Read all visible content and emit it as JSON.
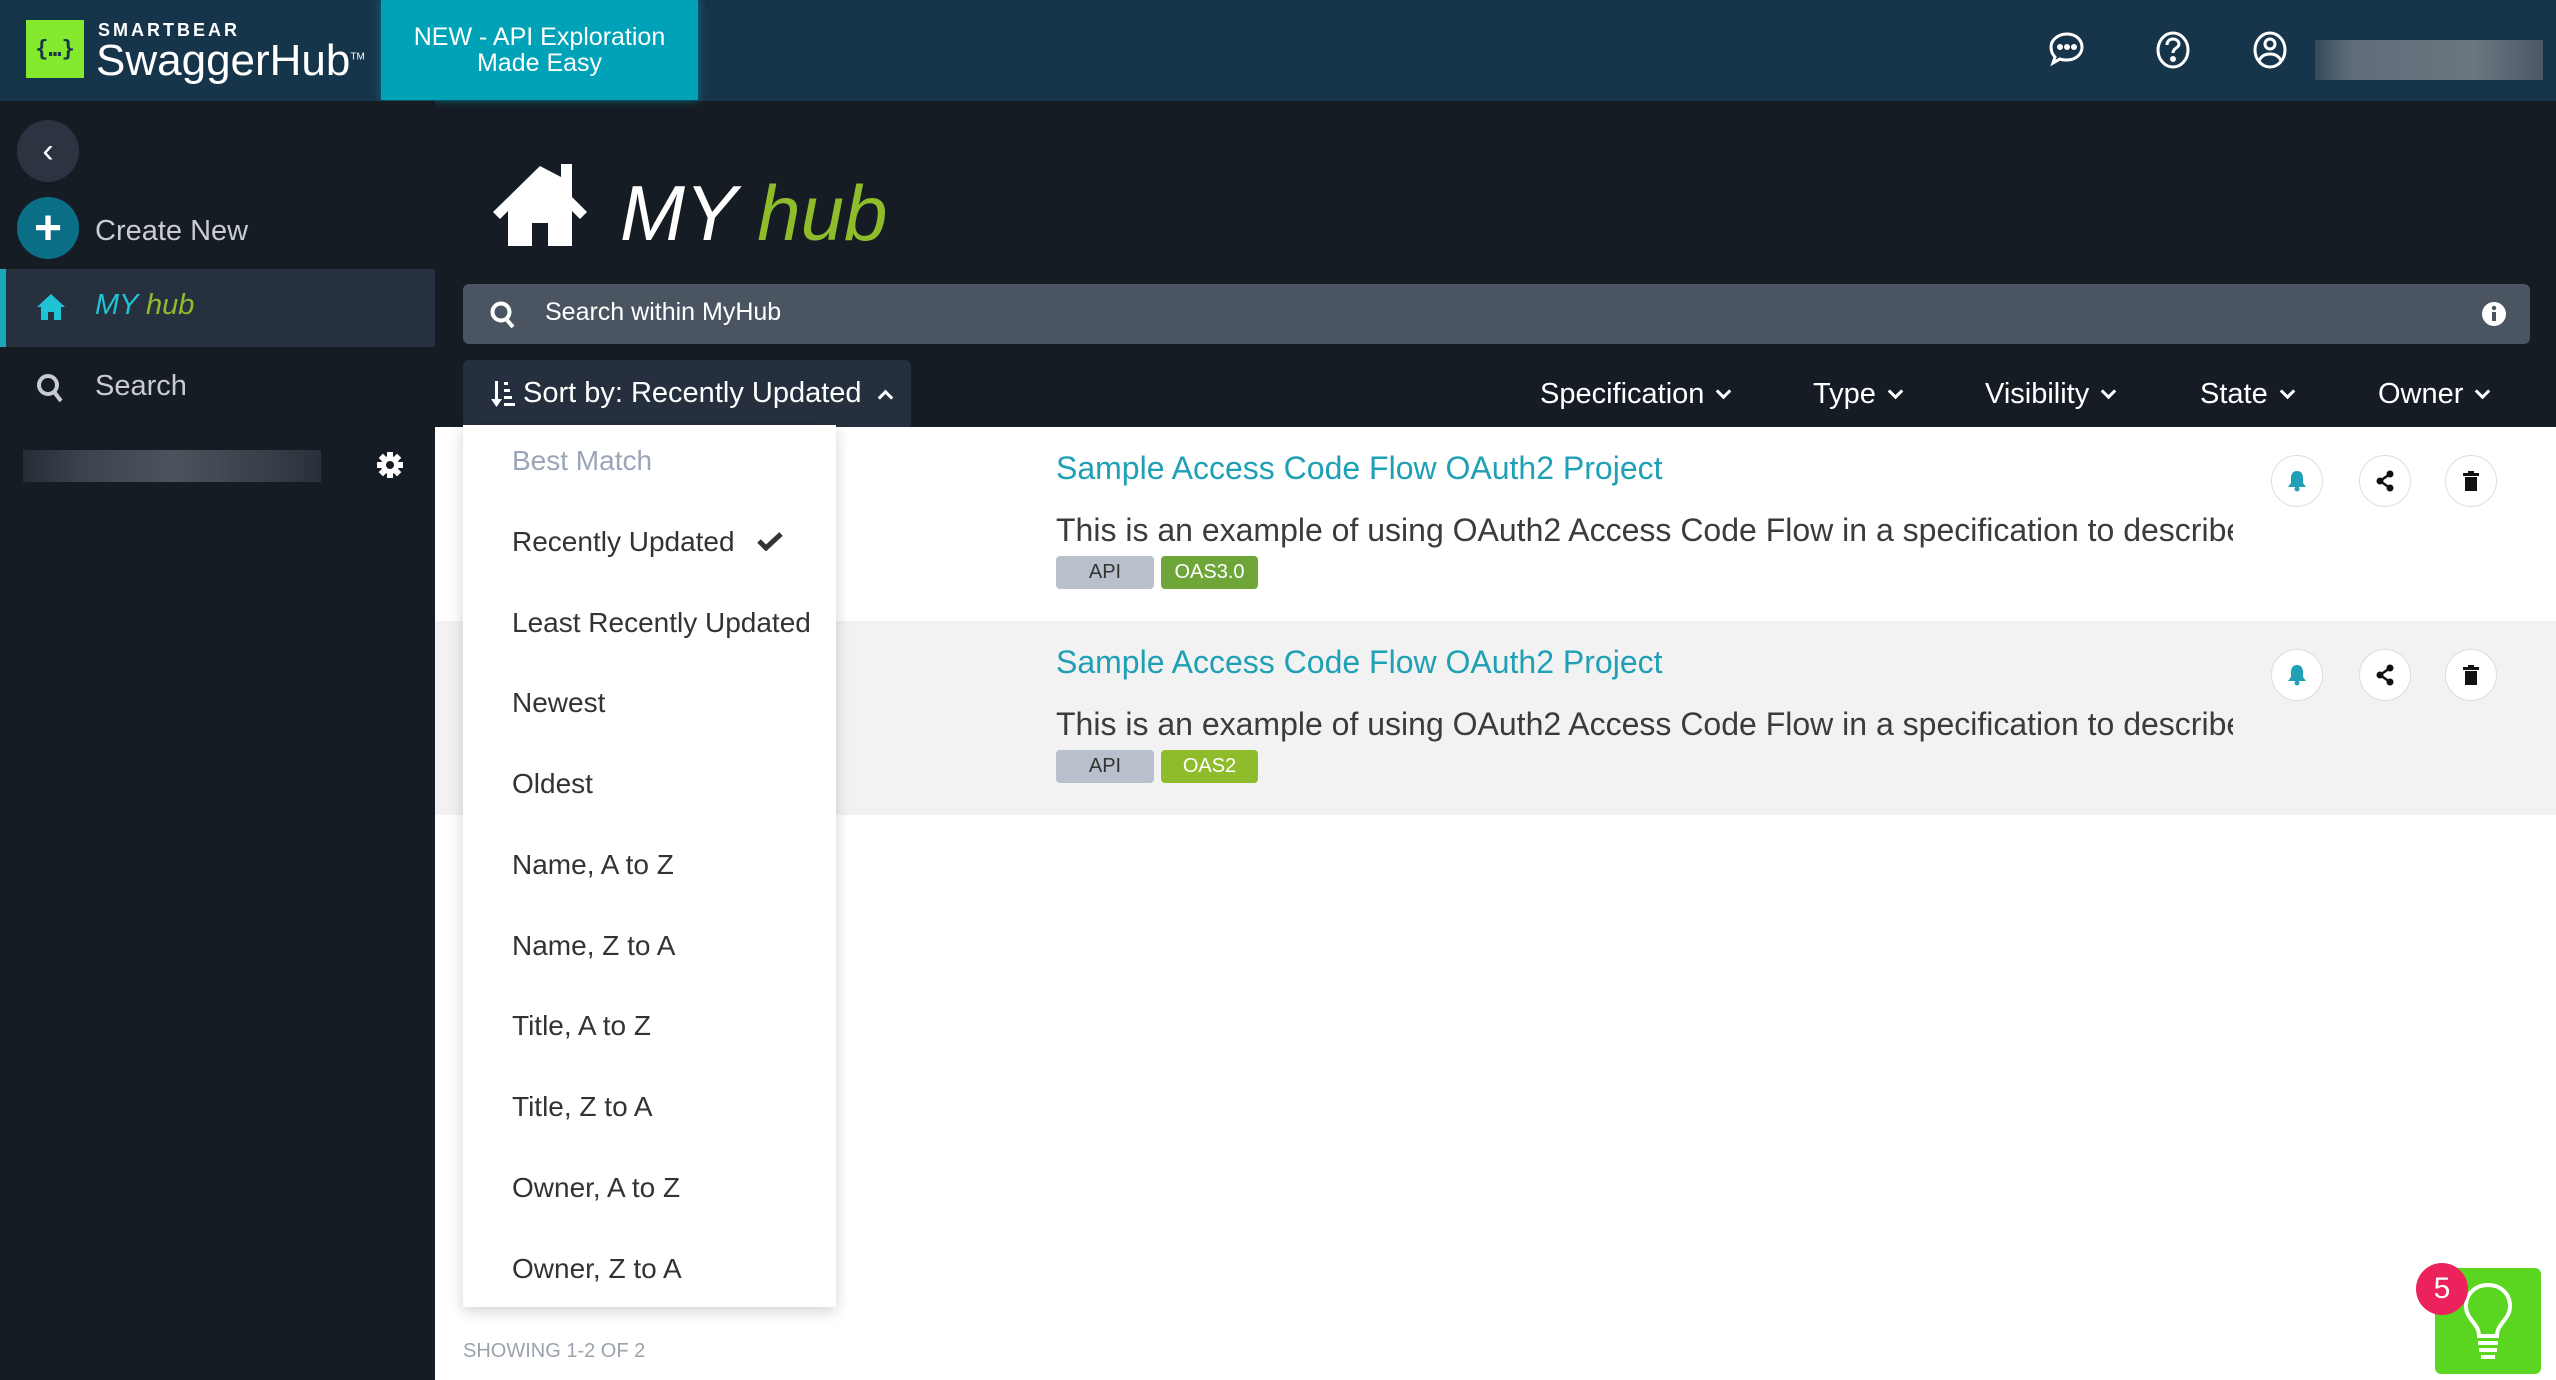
{
  "header": {
    "brand_top": "SMARTBEAR",
    "brand_name": "SwaggerHub",
    "brand_tm": "TM",
    "logo_glyph": "{…}",
    "banner_line1": "NEW - API Exploration",
    "banner_line2": "Made Easy",
    "icons": [
      "chat-icon",
      "help-icon",
      "user-icon"
    ]
  },
  "sidebar": {
    "create_label": "Create New",
    "items": [
      {
        "label_a": "MY",
        "label_b": "hub",
        "icon": "home-icon",
        "active": true
      },
      {
        "label": "Search",
        "icon": "search-icon"
      }
    ]
  },
  "main": {
    "title_a": "MY",
    "title_b": "hub",
    "search_placeholder": "Search within MyHub",
    "sort_label": "Sort by: Recently Updated",
    "filters": [
      "Specification",
      "Type",
      "Visibility",
      "State",
      "Owner"
    ],
    "sort_options": [
      "Best Match",
      "Recently Updated",
      "Least Recently Updated",
      "Newest",
      "Oldest",
      "Name, A to Z",
      "Name, Z to A",
      "Title, A to Z",
      "Title, Z to A",
      "Owner, A to Z",
      "Owner, Z to A"
    ],
    "selected_sort": "Recently Updated",
    "results": [
      {
        "title": "Sample Access Code Flow OAuth2 Project",
        "description": "This is an example of using OAuth2 Access Code Flow in a specification to describe security to your API.",
        "tags": [
          "API",
          "OAS3.0"
        ],
        "tag_color": "#6ea63a"
      },
      {
        "title": "Sample Access Code Flow OAuth2 Project",
        "description": "This is an example of using OAuth2 Access Code Flow in a specification to describe security to your API.",
        "tags": [
          "API",
          "OAS2"
        ],
        "tag_color": "#8fbc2b"
      }
    ],
    "showing": "SHOWING 1-2 OF 2"
  },
  "widget": {
    "badge_count": "5"
  },
  "colors": {
    "accent": "#1fa0b5",
    "header": "#17354a",
    "brand_green": "#85ea2d"
  }
}
